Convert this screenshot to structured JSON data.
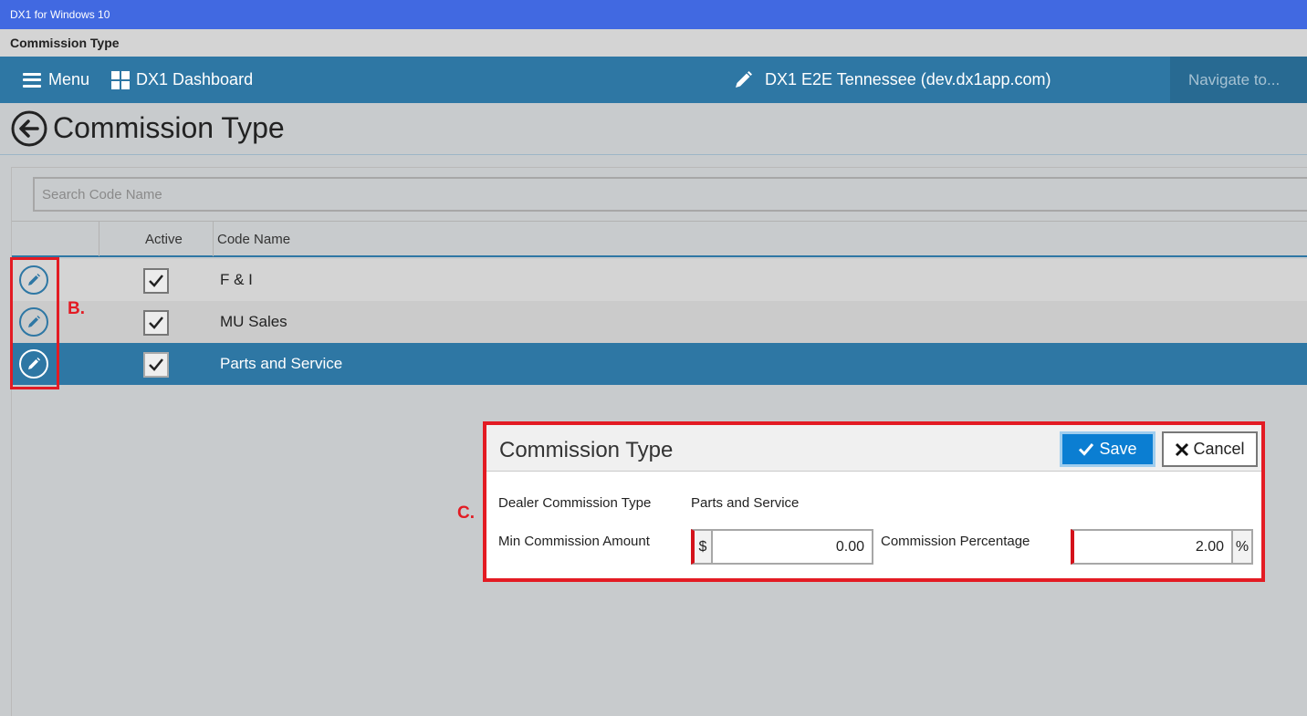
{
  "window": {
    "app_title": "DX1 for Windows 10",
    "page_tab": "Commission Type"
  },
  "nav": {
    "menu_label": "Menu",
    "dashboard_label": "DX1 Dashboard",
    "dealer_label": "DX1 E2E Tennessee (dev.dx1app.com)",
    "navigate_placeholder": "Navigate to..."
  },
  "page": {
    "title": "Commission Type"
  },
  "search": {
    "placeholder": "Search Code Name"
  },
  "table": {
    "columns": [
      "Active",
      "Code Name"
    ],
    "rows": [
      {
        "active": true,
        "code_name": "F & I",
        "selected": false
      },
      {
        "active": true,
        "code_name": "MU Sales",
        "selected": false
      },
      {
        "active": true,
        "code_name": "Parts and Service",
        "selected": true
      }
    ]
  },
  "annotations": {
    "b": "B.",
    "c": "C."
  },
  "dialog": {
    "title": "Commission Type",
    "save_label": "Save",
    "cancel_label": "Cancel",
    "dealer_type_label": "Dealer Commission Type",
    "dealer_type_value": "Parts and Service",
    "min_amount_label": "Min Commission Amount",
    "min_amount_prefix": "$",
    "min_amount_value": "0.00",
    "percentage_label": "Commission Percentage",
    "percentage_value": "2.00",
    "percentage_suffix": "%"
  },
  "colors": {
    "titlebar": "#4169e1",
    "navbar": "#2e77a4",
    "selected_row": "#2e77a4",
    "save_button": "#0b7ed2",
    "annotation": "#e31b23"
  },
  "icons": [
    "hamburger-icon",
    "dashboard-grid-icon",
    "pencil-icon",
    "back-arrow-icon",
    "edit-icon",
    "check-icon",
    "close-icon"
  ]
}
